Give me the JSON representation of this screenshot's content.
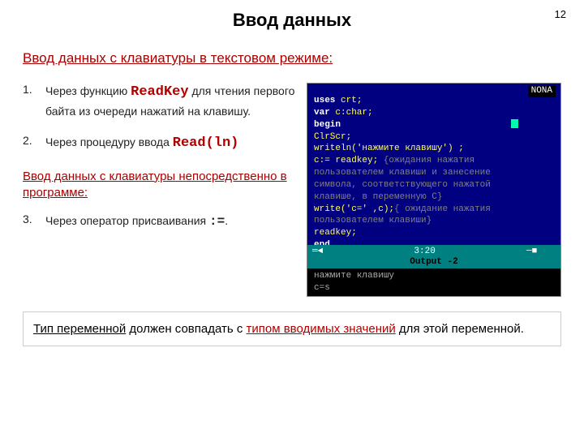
{
  "page_number": "12",
  "title": "Ввод данных",
  "subtitle_keyboard": "Ввод данных с клавиатуры в текстовом режиме:",
  "items": {
    "i1_num": "1.",
    "i1_pre": "Через функцию ",
    "i1_code": "ReadKey",
    "i1_post": " для чтения первого байта из очереди нажатий на клавишу.",
    "i2_num": "2.",
    "i2_pre": "Через процедуру ввода ",
    "i2_code": "Read(ln)",
    "i3_num": "3.",
    "i3_pre": "Через оператор присваивания ",
    "i3_code": ":=",
    "i3_post": "."
  },
  "subtitle_program": "Ввод данных с клавиатуры непосредственно в программе:",
  "ide": {
    "topright": "NONA",
    "lines": {
      "l1a": "uses ",
      "l1b": "crt;",
      "l2a": "var ",
      "l2b": "c:char;",
      "l3": "begin",
      "l4": "ClrScr;",
      "l5a": "writeln(",
      "l5b": "'нажмите клавишу'",
      "l5c": ") ;",
      "l6a": "c:= readkey; ",
      "l6b": "{ожидания нажатия",
      "l7": "пользователем клавиши и занесение",
      "l8": "символа, соответствующего нажатой",
      "l9": "клавише, в переменную C}",
      "l10a": "write(",
      "l10b": "'c=' ,c",
      "l10c": ");",
      "l10d": "{ ожидание нажатия",
      "l11": "пользователем клавиши}",
      "l12": "readkey;",
      "l13": "end."
    },
    "status_left": "═◄",
    "status_time": "3:20",
    "status_right": "─■",
    "output_label": "Output -2",
    "out_line1": "нажмите клавишу",
    "out_line2": "c=s"
  },
  "note": {
    "a": "Тип переменной",
    "b": " должен совпадать с ",
    "c": "типом вводимых значений",
    "d": " для этой переменной."
  }
}
